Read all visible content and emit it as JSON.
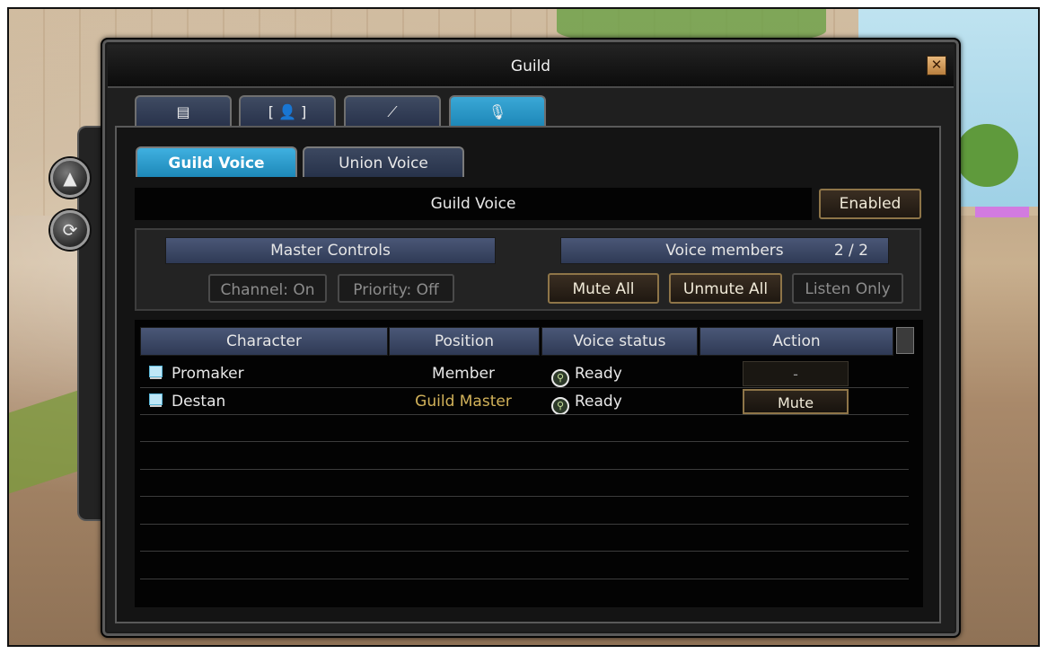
{
  "window": {
    "title": "Guild",
    "close_icon": "close-icon"
  },
  "top_tabs": [
    {
      "icon": "guild-info-icon",
      "glyph": "▤"
    },
    {
      "icon": "member-list-icon",
      "glyph": "[ 👤 ]"
    },
    {
      "icon": "battle-icon",
      "glyph": "⟋"
    },
    {
      "icon": "microphone-icon",
      "glyph": "🎙"
    }
  ],
  "side_buttons": [
    {
      "icon": "arrow-up-icon",
      "glyph": "▲"
    },
    {
      "icon": "refresh-icon",
      "glyph": "⟳"
    }
  ],
  "voice_tabs": [
    {
      "label": "Guild Voice",
      "active": true
    },
    {
      "label": "Union Voice",
      "active": false
    }
  ],
  "voice_bar": {
    "label": "Guild Voice",
    "status_button": "Enabled"
  },
  "master_controls": {
    "header": "Master Controls",
    "channel_button": "Channel: On",
    "priority_button": "Priority: Off"
  },
  "voice_members": {
    "header": "Voice members",
    "count": "2 / 2",
    "mute_all": "Mute All",
    "unmute_all": "Unmute All",
    "listen_only": "Listen Only"
  },
  "table": {
    "columns": [
      "Character",
      "Position",
      "Voice status",
      "Action"
    ],
    "rows": [
      {
        "character": "Promaker",
        "position": "Member",
        "voice_status": "Ready",
        "action": "-"
      },
      {
        "character": "Destan",
        "position": "Guild Master",
        "voice_status": "Ready",
        "action": "Mute"
      }
    ]
  },
  "colors": {
    "tab_active": "#1d88b8",
    "button_border": "#8e7548",
    "guild_master_text": "#d2b25a",
    "header_bg": "#2f3a55"
  }
}
